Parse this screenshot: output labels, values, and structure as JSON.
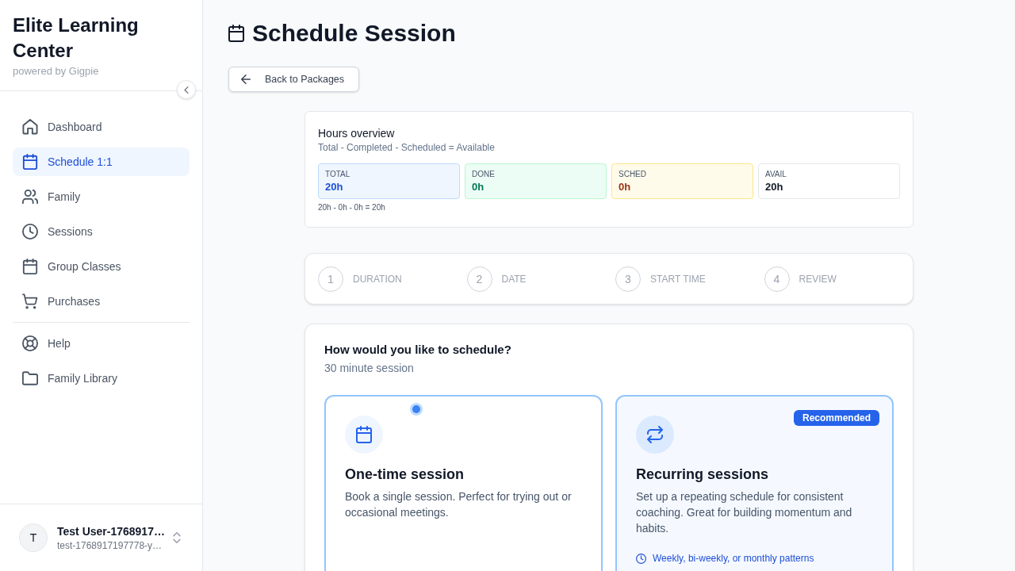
{
  "sidebar": {
    "brand": {
      "title": "Elite Learning Center",
      "subtitle": "powered by Gigpie"
    },
    "nav_sections": [
      {
        "items": [
          {
            "label": "Dashboard",
            "selected": false
          },
          {
            "label": "Schedule 1:1",
            "selected": true
          },
          {
            "label": "Family",
            "selected": false
          },
          {
            "label": "Sessions",
            "selected": false
          },
          {
            "label": "Group Classes",
            "selected": false
          },
          {
            "label": "Purchases",
            "selected": false
          }
        ]
      },
      {
        "items": [
          {
            "label": "Help",
            "selected": false
          },
          {
            "label": "Family Library",
            "selected": false
          }
        ]
      }
    ],
    "user": {
      "initial": "T",
      "name": "Test User-1768917…",
      "email": "test-1768917197778-y…"
    }
  },
  "main": {
    "title": "Schedule Session",
    "back_button": "Back to Packages",
    "hours_overview": {
      "title": "Hours overview",
      "subtitle": "Total - Completed - Scheduled = Available",
      "stats": [
        {
          "kind": "total",
          "label": "TOTAL",
          "value": "20h"
        },
        {
          "kind": "done",
          "label": "DONE",
          "value": "0h"
        },
        {
          "kind": "scheduled",
          "label": "SCHED",
          "value": "0h"
        },
        {
          "kind": "available",
          "label": "AVAIL",
          "value": "20h"
        }
      ],
      "formula": "20h - 0h - 0h = 20h"
    },
    "steps": [
      {
        "number": "1",
        "label": "DURATION"
      },
      {
        "number": "2",
        "label": "DATE"
      },
      {
        "number": "3",
        "label": "START TIME"
      },
      {
        "number": "4",
        "label": "REVIEW"
      }
    ],
    "schedule_options": {
      "question": "How would you like to schedule?",
      "subtitle": "30 minute session",
      "options": [
        {
          "title": "One-time session",
          "description": "Book a single session. Perfect for trying out or occasional meetings.",
          "recommended": false
        },
        {
          "title": "Recurring sessions",
          "description": "Set up a repeating schedule for consistent coaching. Great for building momentum and habits.",
          "recommended": true,
          "badge": "Recommended",
          "feature": "Weekly, bi-weekly, or monthly patterns"
        }
      ]
    }
  }
}
